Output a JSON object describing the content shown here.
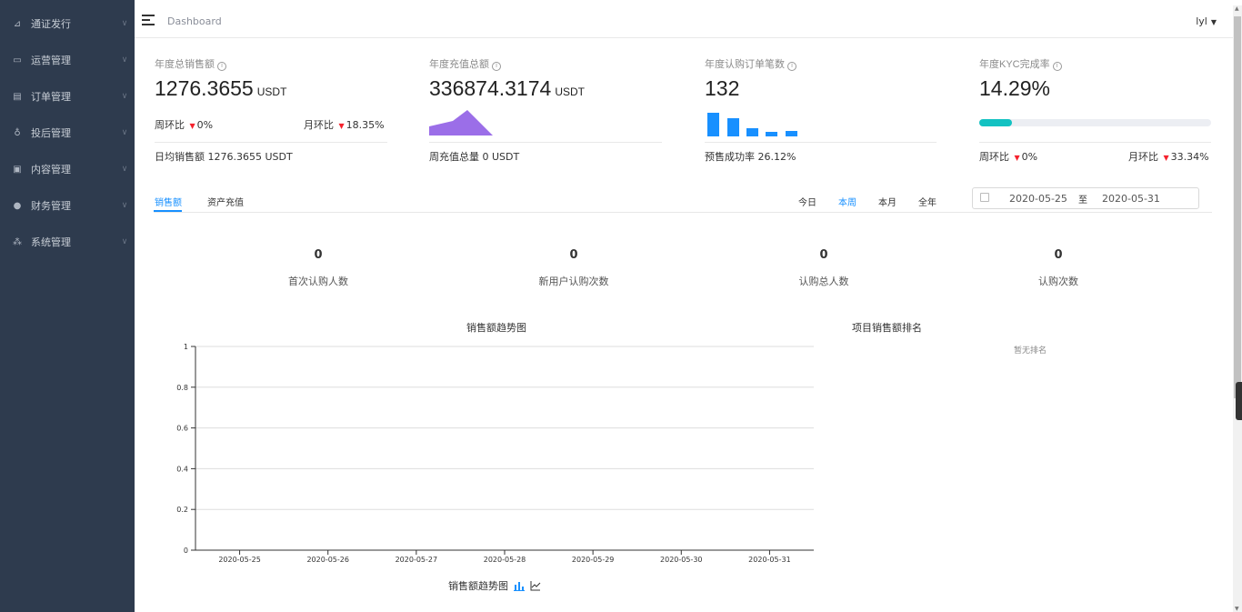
{
  "sidebar": {
    "items": [
      {
        "label": "通证发行",
        "icon": "token-icon"
      },
      {
        "label": "运营管理",
        "icon": "monitor-icon"
      },
      {
        "label": "订单管理",
        "icon": "order-icon"
      },
      {
        "label": "投后管理",
        "icon": "invest-icon"
      },
      {
        "label": "内容管理",
        "icon": "content-icon"
      },
      {
        "label": "财务管理",
        "icon": "finance-icon"
      },
      {
        "label": "系统管理",
        "icon": "org-icon"
      }
    ]
  },
  "header": {
    "breadcrumb": "Dashboard",
    "user": "lyl"
  },
  "stats": [
    {
      "title": "年度总销售额",
      "value": "1276.3655",
      "unit": "USDT",
      "week_label": "周环比",
      "week_value": "0%",
      "month_label": "月环比",
      "month_value": "18.35%",
      "footer": "日均销售额 1276.3655 USDT"
    },
    {
      "title": "年度充值总额",
      "value": "336874.3174",
      "unit": "USDT",
      "footer": "周充值总量 0 USDT"
    },
    {
      "title": "年度认购订单笔数",
      "value": "132",
      "unit": "",
      "footer": "预售成功率 26.12%",
      "bars": [
        1.0,
        0.78,
        0.36,
        0.18,
        0.22
      ]
    },
    {
      "title": "年度KYC完成率",
      "value": "14.29%",
      "unit": "",
      "progress": 0.1429,
      "week_label": "周环比",
      "week_value": "0%",
      "month_label": "月环比",
      "month_value": "33.34%"
    }
  ],
  "tabs": [
    "销售额",
    "资产充值"
  ],
  "periods": [
    "今日",
    "本周",
    "本月",
    "全年"
  ],
  "date_range": {
    "start": "2020-05-25",
    "separator": "至",
    "end": "2020-05-31"
  },
  "metrics": [
    {
      "value": "0",
      "label": "首次认购人数"
    },
    {
      "value": "0",
      "label": "新用户认购次数"
    },
    {
      "value": "0",
      "label": "认购总人数"
    },
    {
      "value": "0",
      "label": "认购次数"
    }
  ],
  "trend_title": "销售额趋势图",
  "rank_title": "项目销售额排名",
  "rank_empty": "暂无排名",
  "legend_label": "销售额趋势图",
  "accent": "#1890ff",
  "chart_data": {
    "type": "line",
    "title": "销售额趋势图",
    "x": [
      "2020-05-25",
      "2020-05-26",
      "2020-05-27",
      "2020-05-28",
      "2020-05-29",
      "2020-05-30",
      "2020-05-31"
    ],
    "series": [
      {
        "values": [
          0,
          0,
          0,
          0,
          0,
          0,
          0
        ]
      }
    ],
    "yticks": [
      "0",
      "0.2",
      "0.4",
      "0.6",
      "0.8",
      "1"
    ],
    "ylim": [
      0,
      1
    ],
    "grid": true
  }
}
